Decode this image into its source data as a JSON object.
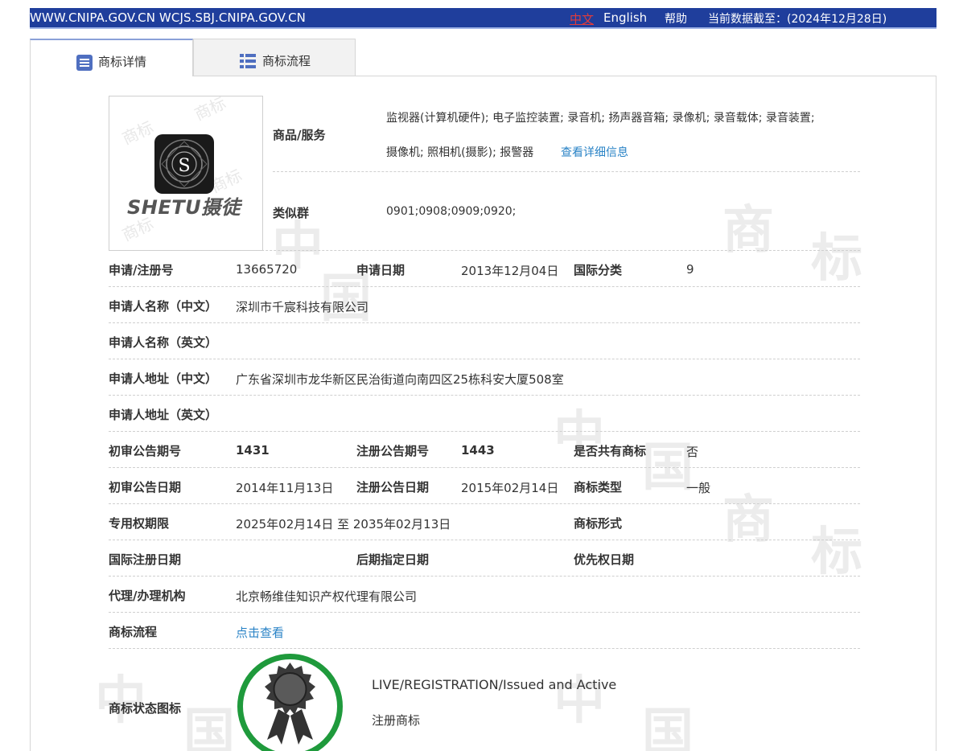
{
  "topbar": {
    "sites": "WWW.CNIPA.GOV.CN WCJS.SBJ.CNIPA.GOV.CN",
    "lang_zh": "中文",
    "lang_en": "English",
    "help": "帮助",
    "as_of": "当前数据截至：(2024年12月28日)"
  },
  "tabs": [
    {
      "label": "商标详情",
      "icon": "document-list-icon"
    },
    {
      "label": "商标流程",
      "icon": "table-list-icon"
    }
  ],
  "logo": {
    "brand_text": "SHETU摄徒",
    "letter": "S"
  },
  "goods": {
    "label": "商品/服务",
    "line1": "监视器(计算机硬件); 电子监控装置; 录音机; 扬声器音箱; 录像机; 录音载体; 录音装置;",
    "line2": "摄像机; 照相机(摄影); 报警器",
    "detail_link": "查看详细信息"
  },
  "similar_group": {
    "label": "类似群",
    "value": "0901;0908;0909;0920;"
  },
  "fields": {
    "reg_no_label": "申请/注册号",
    "reg_no": "13665720",
    "apply_date_label": "申请日期",
    "apply_date": "2013年12月04日",
    "intl_class_label": "国际分类",
    "intl_class": "9",
    "applicant_cn_label": "申请人名称（中文）",
    "applicant_cn": "深圳市千宸科技有限公司",
    "applicant_en_label": "申请人名称（英文）",
    "address_cn_label": "申请人地址（中文）",
    "address_cn": "广东省深圳市龙华新区民治街道向南四区25栋科安大厦508室",
    "address_en_label": "申请人地址（英文）",
    "prelim_no_label": "初审公告期号",
    "prelim_no": "1431",
    "reg_pub_no_label": "注册公告期号",
    "reg_pub_no": "1443",
    "shared_label": "是否共有商标",
    "shared": "否",
    "prelim_date_label": "初审公告日期",
    "prelim_date": "2014年11月13日",
    "reg_pub_date_label": "注册公告日期",
    "reg_pub_date": "2015年02月14日",
    "tm_type_label": "商标类型",
    "tm_type": "一般",
    "term_label": "专用权期限",
    "term": "2025年02月14日 至 2035年02月13日",
    "tm_form_label": "商标形式",
    "intl_reg_date_label": "国际注册日期",
    "later_designation_label": "后期指定日期",
    "priority_date_label": "优先权日期",
    "agent_label": "代理/办理机构",
    "agent": "北京畅维佳知识产权代理有限公司",
    "process_label": "商标流程",
    "process_link": "点击查看"
  },
  "status": {
    "label": "商标状态图标",
    "en": "LIVE/REGISTRATION/Issued and Active",
    "cn": "注册商标",
    "badge_icon": "registered-ribbon-badge-icon"
  },
  "watermark": {
    "chars": [
      "中",
      "国",
      "商",
      "标"
    ]
  },
  "colors": {
    "topbar": "#1f3e9c",
    "link": "#2a83c6",
    "lang_active": "#e23b3b",
    "badge_green": "#1f9a3c"
  }
}
